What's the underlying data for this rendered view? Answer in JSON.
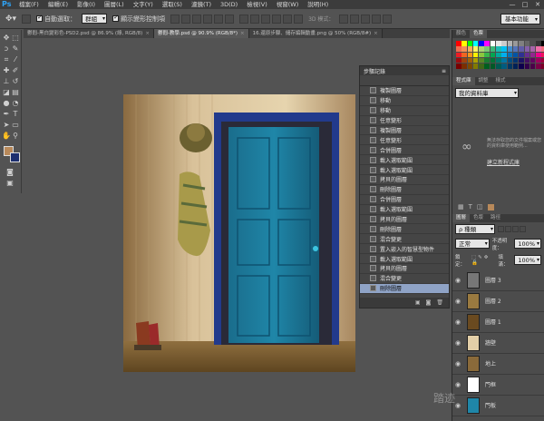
{
  "menubar": {
    "logo": "Ps",
    "items": [
      "檔案(F)",
      "編輯(E)",
      "影像(I)",
      "圖層(L)",
      "文字(Y)",
      "選取(S)",
      "濾鏡(T)",
      "3D(D)",
      "檢視(V)",
      "視窗(W)",
      "說明(H)"
    ],
    "win_min": "—",
    "win_max": "□",
    "win_close": "✕"
  },
  "options": {
    "auto_select_label": "自動選取：",
    "auto_select_value": "群組",
    "show_transform_label": "顯示變形控制項",
    "mode3d_label": "3D 模式：",
    "workspace": "基本功能"
  },
  "tabs": [
    {
      "label": "鬱悶-黑白變彩色-PSD2.psd @ 86.9% (綠, RGB/8)",
      "active": false
    },
    {
      "label": "鬱悶-教學.psd @ 90.9% (RGB/8*)",
      "active": true
    },
    {
      "label": "16.還原步驟、儲存編輯動畫.png @ 50% (RGB/8#)",
      "active": false
    }
  ],
  "history": {
    "title": "步驟記錄",
    "rows": [
      "複製圖層",
      "移動",
      "移動",
      "任意變形",
      "複製圖層",
      "任意變形",
      "合併圖層",
      "載入選取範圍",
      "載入選取範圍",
      "拷貝的圖層",
      "刪除圖層",
      "合併圖層",
      "載入選取範圍",
      "拷貝的圖層",
      "刪除圖層",
      "混合變更",
      "置入嵌入的智慧型物件",
      "載入選取範圍",
      "拷貝的圖層",
      "混合變更",
      "刪除圖層"
    ],
    "selected_index": 20
  },
  "color_panel": {
    "tabs": [
      "顏色",
      "色票"
    ],
    "active": "色票"
  },
  "libraries_panel": {
    "tabs": [
      "程式庫",
      "調整",
      "樣式"
    ],
    "dropdown": "我的資料庫",
    "message": "無法存取您的文件檔案或您的資料庫使用範例...",
    "link": "建立新程式庫"
  },
  "layers_panel": {
    "tabs": [
      "圖層",
      "色版",
      "路徑"
    ],
    "kind_filter": "ρ 種類",
    "blend_mode": "正常",
    "opacity_label": "不透明度：",
    "opacity": "100%",
    "lock_label": "鎖定：",
    "fill_label": "填滿：",
    "fill": "100%",
    "layers": [
      {
        "name": "圖層 3"
      },
      {
        "name": "圖層 2"
      },
      {
        "name": "圖層 1"
      },
      {
        "name": "牆壁"
      },
      {
        "name": "地上"
      },
      {
        "name": "門框"
      },
      {
        "name": "門板"
      }
    ]
  },
  "colors": {
    "foreground": "#b8895a",
    "background": "#1d2f6f",
    "swatch_palette": [
      "#ff0000",
      "#ffff00",
      "#00ff00",
      "#00ffff",
      "#0000ff",
      "#ff00ff",
      "#ffffff",
      "#e6e6e6",
      "#cccccc",
      "#b3b3b3",
      "#999999",
      "#808080",
      "#666666",
      "#4d4d4d",
      "#333333",
      "#000000",
      "#f26c4f",
      "#f68e55",
      "#fbaf5c",
      "#fff467",
      "#acd372",
      "#7cc576",
      "#3bb878",
      "#1abbb4",
      "#00bff3",
      "#438ccb",
      "#5574b9",
      "#605ca8",
      "#855fa8",
      "#a763a9",
      "#ef6ea8",
      "#f16d7e",
      "#ed1c24",
      "#f26522",
      "#f7941d",
      "#fff200",
      "#8dc63f",
      "#39b54a",
      "#00a651",
      "#00a99d",
      "#00aeef",
      "#0072bc",
      "#0054a6",
      "#2e3192",
      "#662d91",
      "#92278f",
      "#ec008c",
      "#ed145b",
      "#9e0b0f",
      "#a0410d",
      "#a36209",
      "#aba000",
      "#598527",
      "#1a7b30",
      "#007236",
      "#00746b",
      "#0076a3",
      "#004b80",
      "#003471",
      "#1b1464",
      "#440e62",
      "#630460",
      "#9e005d",
      "#9e0039",
      "#790000",
      "#7b2e00",
      "#7d4900",
      "#827b00",
      "#406618",
      "#005e20",
      "#005826",
      "#005952",
      "#005b7f",
      "#003663",
      "#002157",
      "#0d004c",
      "#32004b",
      "#4b0049",
      "#7b0046",
      "#7a0026"
    ]
  },
  "watermark": "踏迹"
}
